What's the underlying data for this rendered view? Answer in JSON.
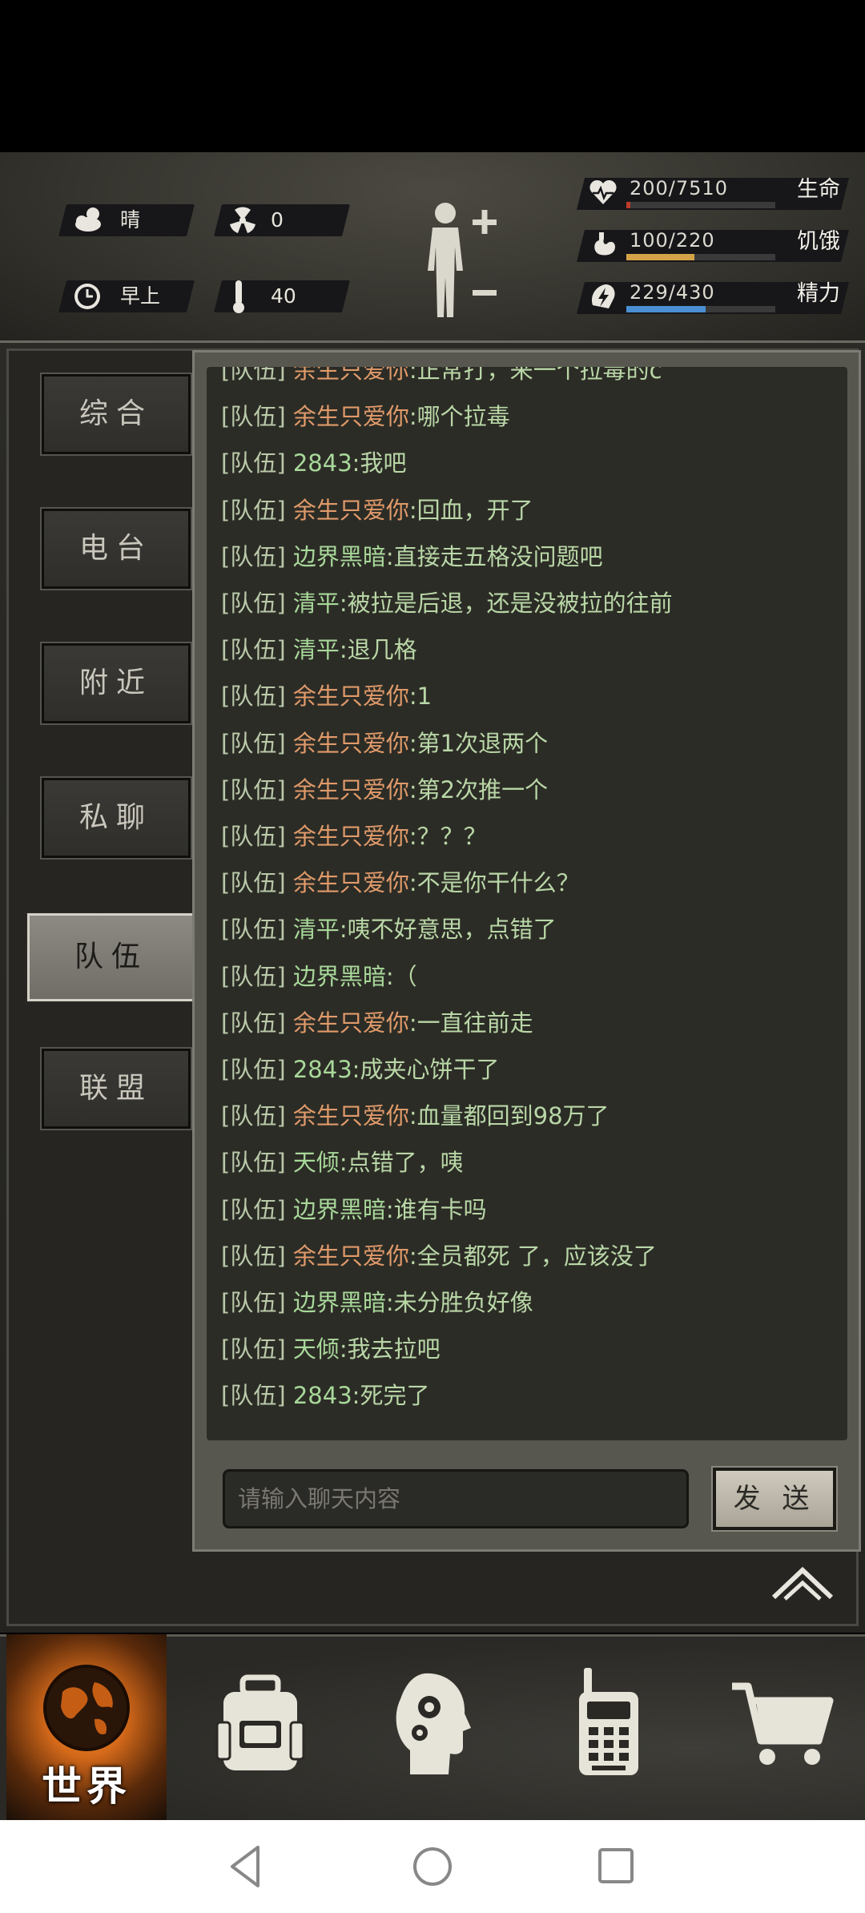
{
  "status": {
    "weather": "晴",
    "radiation": "0",
    "time_of_day": "早上",
    "temperature": "40"
  },
  "stats": {
    "life": {
      "value": "200/7510",
      "label": "生命",
      "fraction": 0.027,
      "color": "#c0392b"
    },
    "hunger": {
      "value": "100/220",
      "label": "饥饿",
      "fraction": 0.455,
      "color": "#d4a347"
    },
    "energy": {
      "value": "229/430",
      "label": "精力",
      "fraction": 0.533,
      "color": "#4a8fd4"
    }
  },
  "tabs": [
    {
      "label": "综合"
    },
    {
      "label": "电台"
    },
    {
      "label": "附近"
    },
    {
      "label": "私聊"
    },
    {
      "label": "队伍"
    },
    {
      "label": "联盟"
    }
  ],
  "active_tab": "队伍",
  "chat": {
    "channel": "[队伍]",
    "messages": [
      {
        "name": "余生只爱你",
        "text": ":正常打，来一个拉毒的c",
        "orange": true,
        "partial": true
      },
      {
        "name": "余生只爱你",
        "text": ":哪个拉毒",
        "orange": true
      },
      {
        "name": "2843",
        "text": ":我吧",
        "orange": false
      },
      {
        "name": "余生只爱你",
        "text": ":回血，开了",
        "orange": true
      },
      {
        "name": "边界黑暗",
        "text": ":直接走五格没问题吧",
        "orange": false
      },
      {
        "name": "清平",
        "text": ":被拉是后退，还是没被拉的往前",
        "orange": false
      },
      {
        "name": "清平",
        "text": ":退几格",
        "orange": false
      },
      {
        "name": "余生只爱你",
        "text": ":1",
        "orange": true
      },
      {
        "name": "余生只爱你",
        "text": ":第1次退两个",
        "orange": true
      },
      {
        "name": "余生只爱你",
        "text": ":第2次推一个",
        "orange": true
      },
      {
        "name": "余生只爱你",
        "text": ":？？？",
        "orange": true
      },
      {
        "name": "余生只爱你",
        "text": ":不是你干什么？",
        "orange": true
      },
      {
        "name": "清平",
        "text": ":咦不好意思，点错了",
        "orange": false
      },
      {
        "name": "边界黑暗",
        "text": ":（",
        "orange": false
      },
      {
        "name": "余生只爱你",
        "text": ":一直往前走",
        "orange": true
      },
      {
        "name": "2843",
        "text": ":成夹心饼干了",
        "orange": false
      },
      {
        "name": "余生只爱你",
        "text": ":血量都回到98万了",
        "orange": true
      },
      {
        "name": "天倾",
        "text": ":点错了，咦",
        "orange": false
      },
      {
        "name": "边界黑暗",
        "text": ":谁有卡吗",
        "orange": false
      },
      {
        "name": "余生只爱你",
        "text": ":全员都死 了，应该没了",
        "orange": true
      },
      {
        "name": "边界黑暗",
        "text": ":未分胜负好像",
        "orange": false
      },
      {
        "name": "天倾",
        "text": ":我去拉吧",
        "orange": false
      },
      {
        "name": "2843",
        "text": ":死完了",
        "orange": false
      }
    ],
    "input_placeholder": "请输入聊天内容",
    "send_label": "发 送"
  },
  "bottom_nav": {
    "world_label": "世界",
    "items": [
      "world-icon",
      "backpack-icon",
      "skills-head-icon",
      "radio-icon",
      "shop-cart-icon"
    ]
  }
}
